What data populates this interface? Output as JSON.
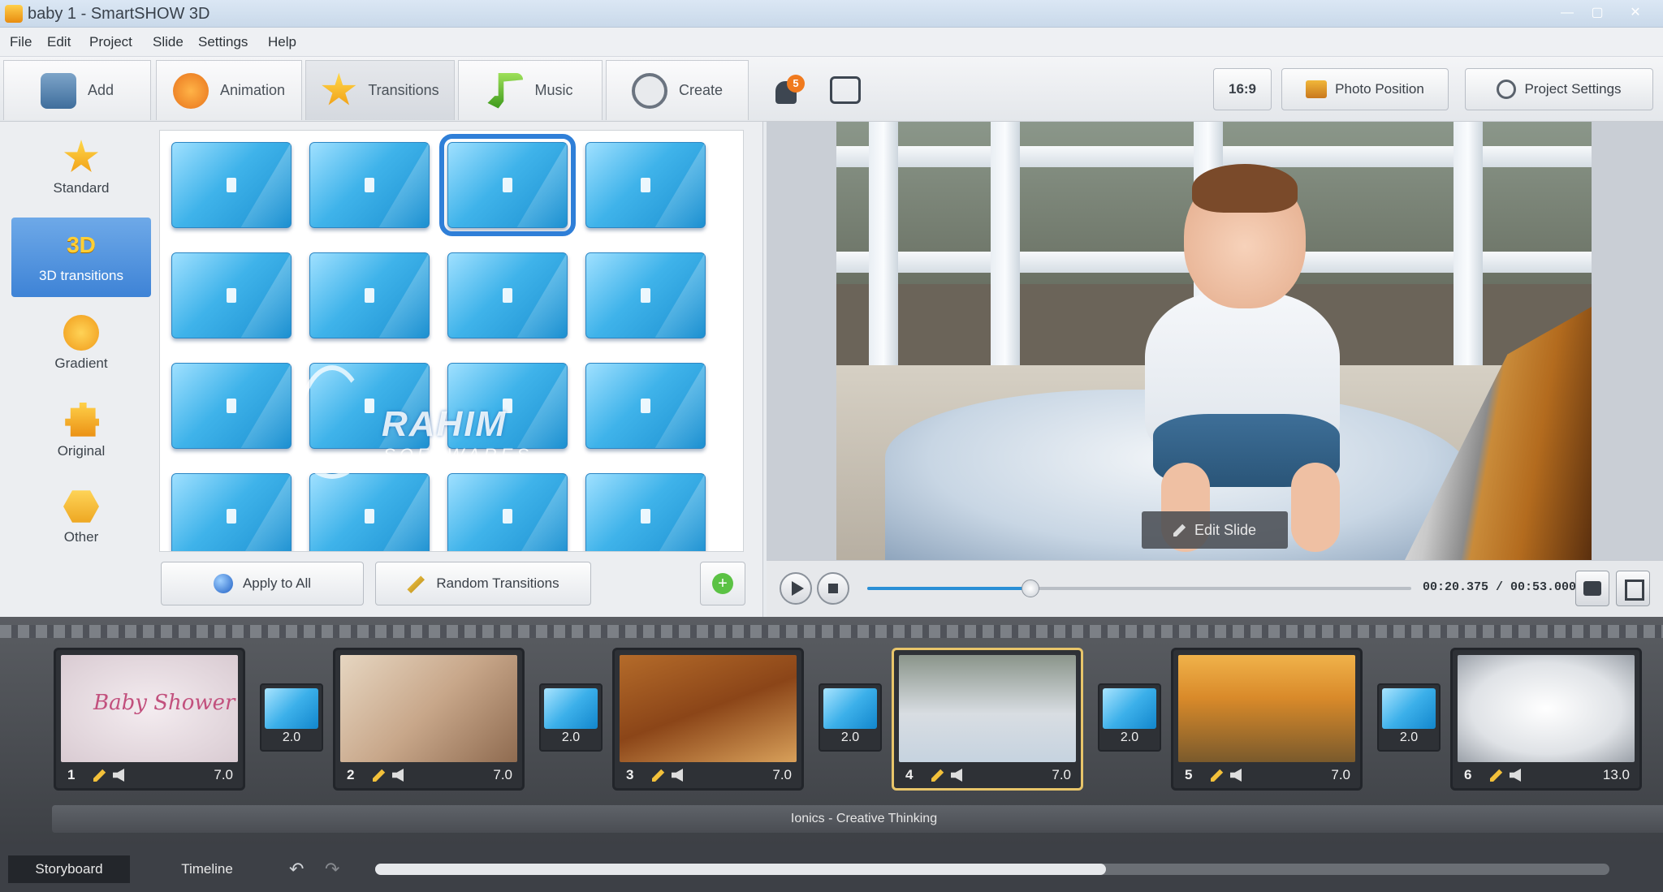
{
  "window": {
    "title": "baby 1 - SmartSHOW 3D",
    "min": "—",
    "max": "▢",
    "close": "✕"
  },
  "menu": [
    "File",
    "Edit",
    "Project",
    "Slide",
    "Settings",
    "Help"
  ],
  "tabs": [
    {
      "label": "Add",
      "icon": "photo-add-icon"
    },
    {
      "label": "Animation",
      "icon": "palette-icon"
    },
    {
      "label": "Transitions",
      "icon": "star-icon"
    },
    {
      "label": "Music",
      "icon": "music-note-icon"
    },
    {
      "label": "Create",
      "icon": "film-reel-icon"
    }
  ],
  "notifications": {
    "count": "5"
  },
  "header_buttons": {
    "ratio": "16:9",
    "photo_position": "Photo Position",
    "project_settings": "Project Settings"
  },
  "categories": [
    {
      "label": "Standard",
      "icon": "star-icon"
    },
    {
      "label": "3D transitions",
      "icon": "3d-icon",
      "badge": "3D"
    },
    {
      "label": "Gradient",
      "icon": "gradient-icon"
    },
    {
      "label": "Original",
      "icon": "puzzle-icon"
    },
    {
      "label": "Other",
      "icon": "hexagon-icon"
    }
  ],
  "active_category": "3D transitions",
  "selected_transition_index": 2,
  "transition_count": 16,
  "watermark": {
    "title": "RAHIM",
    "subtitle": "SOFTWARES"
  },
  "panel_buttons": {
    "apply_all": "Apply to All",
    "random": "Random Transitions"
  },
  "preview": {
    "edit_slide": "Edit Slide"
  },
  "player": {
    "timecode": "00:20.375 / 00:53.000",
    "progress": 0.3
  },
  "slides": [
    {
      "num": "1",
      "duration": "7.0",
      "title_text": "Baby Shower"
    },
    {
      "num": "2",
      "duration": "7.0"
    },
    {
      "num": "3",
      "duration": "7.0"
    },
    {
      "num": "4",
      "duration": "7.0"
    },
    {
      "num": "5",
      "duration": "7.0"
    },
    {
      "num": "6",
      "duration": "13.0"
    }
  ],
  "transitions": [
    "2.0",
    "2.0",
    "2.0",
    "2.0",
    "2.0"
  ],
  "audio_track": "Ionics - Creative Thinking",
  "bottom_tabs": {
    "storyboard": "Storyboard",
    "timeline": "Timeline"
  },
  "colors": {
    "accent": "#2f7fd8",
    "selected_slide": "#e8c56a",
    "badge": "#f07a1e"
  }
}
